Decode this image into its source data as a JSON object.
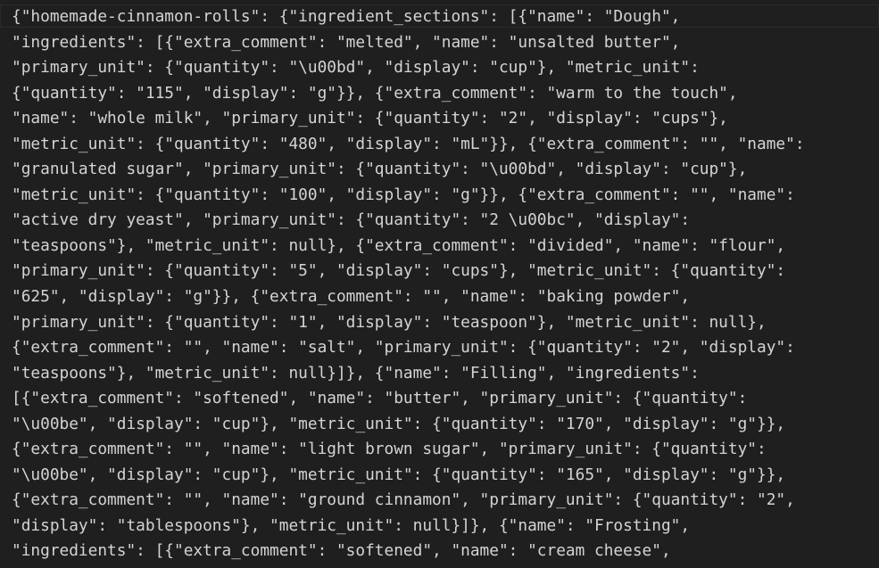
{
  "editor": {
    "lines": [
      "{\"homemade-cinnamon-rolls\": {\"ingredient_sections\": [{\"name\": \"Dough\",",
      "\"ingredients\": [{\"extra_comment\": \"melted\", \"name\": \"unsalted butter\",",
      "\"primary_unit\": {\"quantity\": \"\\u00bd\", \"display\": \"cup\"}, \"metric_unit\":",
      "{\"quantity\": \"115\", \"display\": \"g\"}}, {\"extra_comment\": \"warm to the touch\",",
      "\"name\": \"whole milk\", \"primary_unit\": {\"quantity\": \"2\", \"display\": \"cups\"},",
      "\"metric_unit\": {\"quantity\": \"480\", \"display\": \"mL\"}}, {\"extra_comment\": \"\", \"name\":",
      "\"granulated sugar\", \"primary_unit\": {\"quantity\": \"\\u00bd\", \"display\": \"cup\"},",
      "\"metric_unit\": {\"quantity\": \"100\", \"display\": \"g\"}}, {\"extra_comment\": \"\", \"name\":",
      "\"active dry yeast\", \"primary_unit\": {\"quantity\": \"2 \\u00bc\", \"display\":",
      "\"teaspoons\"}, \"metric_unit\": null}, {\"extra_comment\": \"divided\", \"name\": \"flour\",",
      "\"primary_unit\": {\"quantity\": \"5\", \"display\": \"cups\"}, \"metric_unit\": {\"quantity\":",
      "\"625\", \"display\": \"g\"}}, {\"extra_comment\": \"\", \"name\": \"baking powder\",",
      "\"primary_unit\": {\"quantity\": \"1\", \"display\": \"teaspoon\"}, \"metric_unit\": null},",
      "{\"extra_comment\": \"\", \"name\": \"salt\", \"primary_unit\": {\"quantity\": \"2\", \"display\":",
      "\"teaspoons\"}, \"metric_unit\": null}]}, {\"name\": \"Filling\", \"ingredients\":",
      "[{\"extra_comment\": \"softened\", \"name\": \"butter\", \"primary_unit\": {\"quantity\":",
      "\"\\u00be\", \"display\": \"cup\"}, \"metric_unit\": {\"quantity\": \"170\", \"display\": \"g\"}},",
      "{\"extra_comment\": \"\", \"name\": \"light brown sugar\", \"primary_unit\": {\"quantity\":",
      "\"\\u00be\", \"display\": \"cup\"}, \"metric_unit\": {\"quantity\": \"165\", \"display\": \"g\"}},",
      "{\"extra_comment\": \"\", \"name\": \"ground cinnamon\", \"primary_unit\": {\"quantity\": \"2\",",
      "\"display\": \"tablespoons\"}, \"metric_unit\": null}]}, {\"name\": \"Frosting\",",
      "\"ingredients\": [{\"extra_comment\": \"softened\", \"name\": \"cream cheese\","
    ]
  }
}
